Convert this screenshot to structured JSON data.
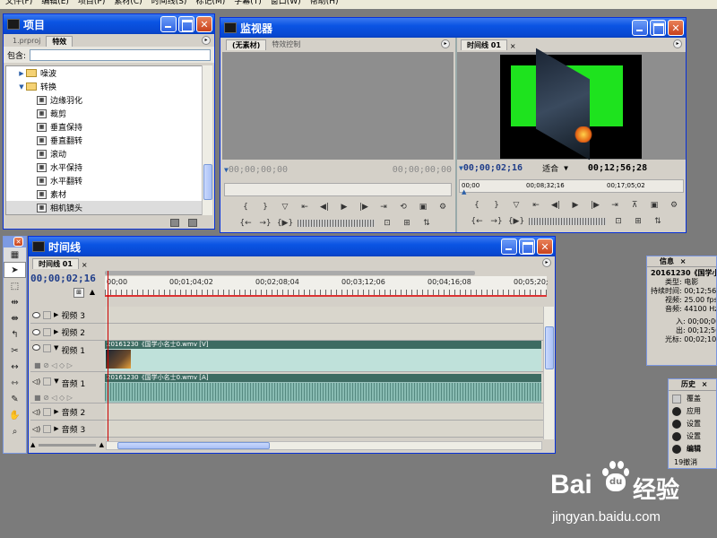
{
  "menubar": [
    "文件(F)",
    "编辑(E)",
    "项目(P)",
    "素材(C)",
    "时间线(S)",
    "标记(M)",
    "字幕(T)",
    "窗口(W)",
    "帮助(H)"
  ],
  "project": {
    "title": "项目",
    "tabs": [
      "1.prproj",
      "特效"
    ],
    "search_label": "包含:",
    "search_value": "",
    "items": [
      {
        "label": "噪波",
        "type": "folder",
        "expanded": false
      },
      {
        "label": "转换",
        "type": "folder",
        "expanded": true
      },
      {
        "label": "边缘羽化",
        "type": "effect"
      },
      {
        "label": "裁剪",
        "type": "effect"
      },
      {
        "label": "垂直保持",
        "type": "effect"
      },
      {
        "label": "垂直翻转",
        "type": "effect"
      },
      {
        "label": "滚动",
        "type": "effect"
      },
      {
        "label": "水平保持",
        "type": "effect"
      },
      {
        "label": "水平翻转",
        "type": "effect"
      },
      {
        "label": "素材",
        "type": "effect"
      },
      {
        "label": "相机镜头",
        "type": "effect",
        "selected": true
      }
    ]
  },
  "monitor": {
    "title": "监视器",
    "source_tabs": [
      "(无素材)",
      "特效控制"
    ],
    "source_tc_left": "00;00;00;00",
    "source_tc_right": "00;00;00;00",
    "program_tab": "时间线 01",
    "program_tc": "00;00;02;16",
    "fit_label": "适合",
    "program_duration": "00;12;56;28",
    "mini_ruler": [
      "00;00",
      "00;08;32;16",
      "00;17;05;02"
    ]
  },
  "timeline": {
    "title": "时间线",
    "tab": "时间线 01",
    "current_tc": "00;00;02;16",
    "ruler_labels": [
      "00;00",
      "00;01;04;02",
      "00;02;08;04",
      "00;03;12;06",
      "00;04;16;08",
      "00;05;20;"
    ],
    "tracks": [
      {
        "name": "视频 3",
        "kind": "video",
        "clip": ""
      },
      {
        "name": "视频 2",
        "kind": "video",
        "clip": ""
      },
      {
        "name": "视频 1",
        "kind": "video",
        "clip": "20161230《国学小名士0.wmv [V]"
      },
      {
        "name": "音频 1",
        "kind": "audio",
        "clip": "20161230《国学小名士0.wmv [A]"
      },
      {
        "name": "音频 2",
        "kind": "audio",
        "clip": ""
      },
      {
        "name": "音频 3",
        "kind": "audio",
        "clip": ""
      }
    ]
  },
  "info": {
    "tab": "信息",
    "lines": [
      "20161230《国学小",
      "类型: 电影",
      "持续时间: 00;12;56;2",
      "视频: 25.00 fps,",
      "音频: 44100 Hz -",
      "入: 00;00;00;",
      "出: 00;12;56;2",
      "光标: 00;02;10;1"
    ]
  },
  "history": {
    "tab": "历史",
    "items": [
      "覆盖",
      "应用",
      "设置",
      "设置",
      "编辑"
    ],
    "footer": "19撤消"
  },
  "watermark": {
    "brand": "Bai",
    "paw": "du",
    "cn": "经验",
    "url": "jingyan.baidu.com"
  }
}
